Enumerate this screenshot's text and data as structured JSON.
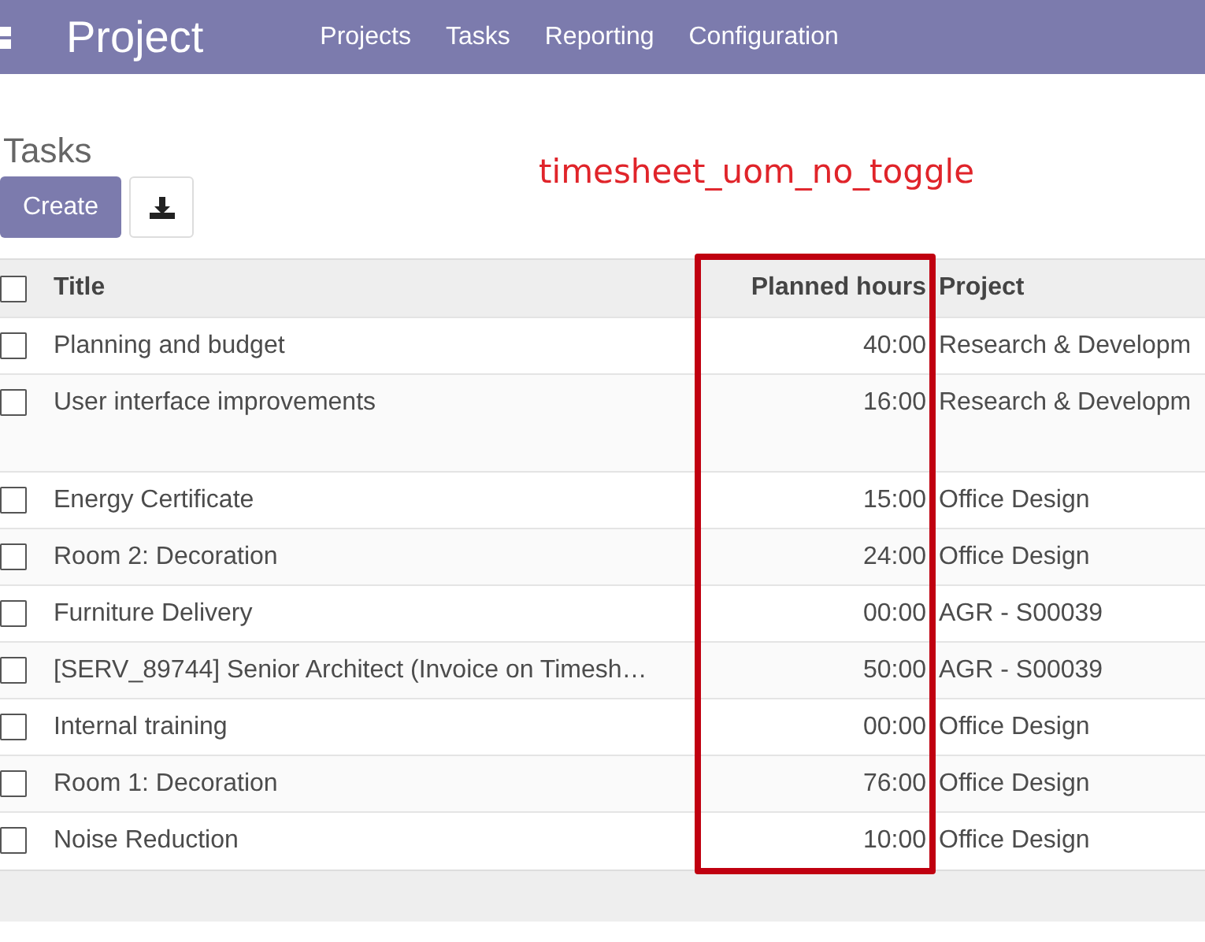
{
  "navbar": {
    "app_title": "Project",
    "menu": [
      "Projects",
      "Tasks",
      "Reporting",
      "Configuration"
    ]
  },
  "page_title": "Tasks",
  "annotation": "timesheet_uom_no_toggle",
  "create_button": "Create",
  "table": {
    "header_checked": false,
    "columns": [
      "Title",
      "Planned hours",
      "Project"
    ],
    "rows": [
      {
        "title": "Planning and budget",
        "planned_hours": "40:00",
        "project": "Research & Developm",
        "checked": false,
        "tall": false
      },
      {
        "title": "User interface improvements",
        "planned_hours": "16:00",
        "project": "Research & Developm",
        "checked": false,
        "tall": true
      },
      {
        "title": "Energy Certificate",
        "planned_hours": "15:00",
        "project": "Office Design",
        "checked": false,
        "tall": false
      },
      {
        "title": "Room 2: Decoration",
        "planned_hours": "24:00",
        "project": "Office Design",
        "checked": false,
        "tall": false
      },
      {
        "title": "Furniture Delivery",
        "planned_hours": "00:00",
        "project": "AGR - S00039",
        "checked": false,
        "tall": false
      },
      {
        "title": "[SERV_89744] Senior Architect (Invoice on Timesh…",
        "planned_hours": "50:00",
        "project": "AGR - S00039",
        "checked": false,
        "tall": false
      },
      {
        "title": "Internal training",
        "planned_hours": "00:00",
        "project": "Office Design",
        "checked": false,
        "tall": false
      },
      {
        "title": "Room 1: Decoration",
        "planned_hours": "76:00",
        "project": "Office Design",
        "checked": false,
        "tall": false
      },
      {
        "title": "Noise Reduction",
        "planned_hours": "10:00",
        "project": "Office Design",
        "checked": false,
        "tall": false
      }
    ]
  }
}
